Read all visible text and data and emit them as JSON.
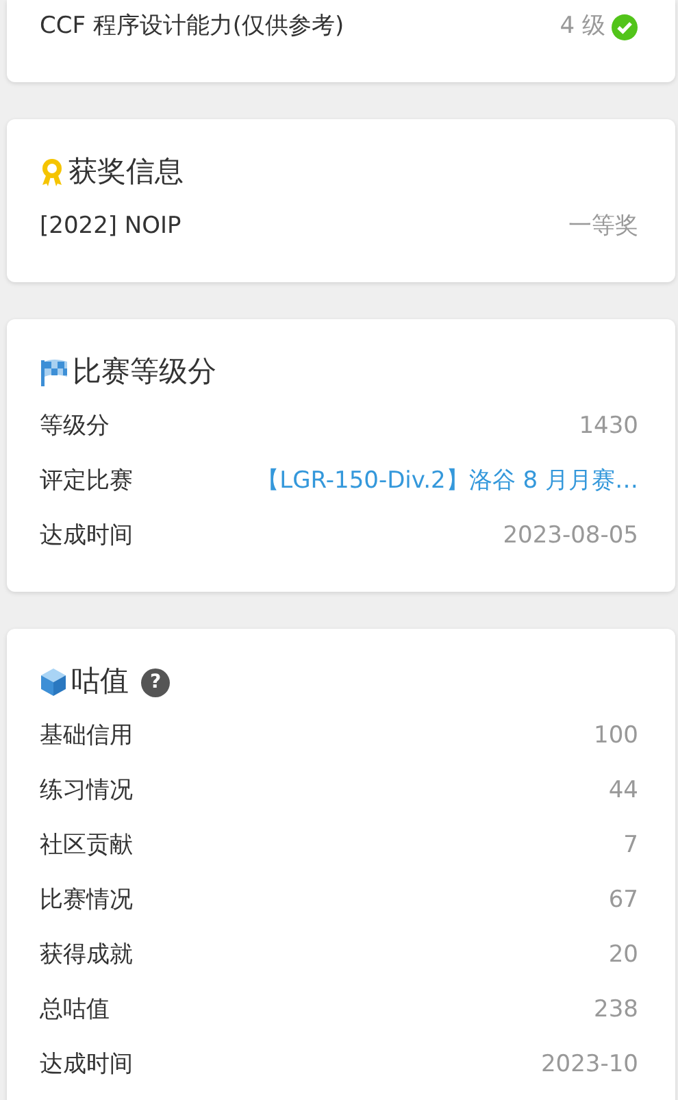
{
  "cards": [
    {
      "rows": [
        {
          "label": "CCF 程序设计能力(仅供参考)",
          "value": "4 级",
          "kind": "verified"
        }
      ]
    },
    {
      "title": "获奖信息",
      "kind": "award",
      "help": false,
      "rows": [
        {
          "label": "[2022] NOIP",
          "value": "一等奖",
          "kind": "text"
        }
      ]
    },
    {
      "title": "比赛等级分",
      "kind": "flag",
      "help": false,
      "rows": [
        {
          "label": "等级分",
          "value": "1430",
          "kind": "text"
        },
        {
          "label": "评定比赛",
          "value": "【LGR-150-Div.2】洛谷 8 月月赛…",
          "kind": "link"
        },
        {
          "label": "达成时间",
          "value": "2023-08-05",
          "kind": "text"
        }
      ]
    },
    {
      "title": "咕值",
      "kind": "cube",
      "help": true,
      "help_text": "?",
      "rows": [
        {
          "label": "基础信用",
          "value": "100",
          "kind": "text"
        },
        {
          "label": "练习情况",
          "value": "44",
          "kind": "text"
        },
        {
          "label": "社区贡献",
          "value": "7",
          "kind": "text"
        },
        {
          "label": "比赛情况",
          "value": "67",
          "kind": "text"
        },
        {
          "label": "获得成就",
          "value": "20",
          "kind": "text"
        },
        {
          "label": "总咕值",
          "value": "238",
          "kind": "text"
        },
        {
          "label": "达成时间",
          "value": "2023-10",
          "kind": "text"
        }
      ]
    }
  ]
}
